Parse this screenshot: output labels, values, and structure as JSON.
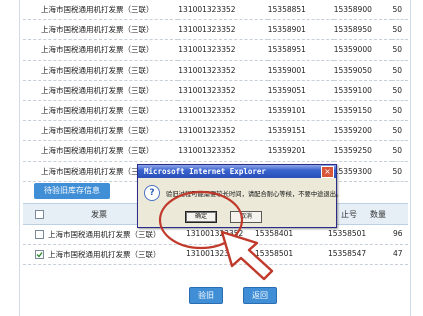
{
  "upper_rows": [
    {
      "name": "上海市国税通用机打发票（三联）",
      "code": "131001323352",
      "start": "15358851",
      "end": "15358900",
      "qty": "50"
    },
    {
      "name": "上海市国税通用机打发票（三联）",
      "code": "131001323352",
      "start": "15358901",
      "end": "15358950",
      "qty": "50"
    },
    {
      "name": "上海市国税通用机打发票（三联）",
      "code": "131001323352",
      "start": "15358951",
      "end": "15359000",
      "qty": "50"
    },
    {
      "name": "上海市国税通用机打发票（三联）",
      "code": "131001323352",
      "start": "15359001",
      "end": "15359050",
      "qty": "50"
    },
    {
      "name": "上海市国税通用机打发票（三联）",
      "code": "131001323352",
      "start": "15359051",
      "end": "15359100",
      "qty": "50"
    },
    {
      "name": "上海市国税通用机打发票（三联）",
      "code": "131001323352",
      "start": "15359101",
      "end": "15359150",
      "qty": "50"
    },
    {
      "name": "上海市国税通用机打发票（三联）",
      "code": "131001323352",
      "start": "15359151",
      "end": "15359200",
      "qty": "50"
    },
    {
      "name": "上海市国税通用机打发票（三联）",
      "code": "131001323352",
      "start": "15359201",
      "end": "15359250",
      "qty": "50"
    },
    {
      "name": "上海市国税通用机打发票（三联）",
      "code": "131001323352",
      "start": "15359251",
      "end": "15359300",
      "qty": "50"
    }
  ],
  "section_button": "待验旧库存信息",
  "lower_header": {
    "col1": "发票",
    "col4": "止号",
    "col5": "数量"
  },
  "lower_rows": [
    {
      "name": "上海市国税通用机打发票（三联）",
      "code": "131001323352",
      "start": "15358401",
      "end": "15358501",
      "qty": "96",
      "checked": false
    },
    {
      "name": "上海市国税通用机打发票（三联）",
      "code": "131001323352",
      "start": "15358501",
      "end": "15358547",
      "qty": "47",
      "checked": true
    }
  ],
  "buttons": {
    "verify": "验旧",
    "back": "返回"
  },
  "dialog": {
    "title": "Microsoft Internet Explorer",
    "message": "验旧过程可能需要较长时间，请配合耐心等候，不要中途退出。",
    "ok": "确定",
    "cancel": "取消",
    "icon": "question-icon"
  },
  "colors": {
    "accent": "#3f8ed6",
    "annotation": "#c0392b"
  }
}
